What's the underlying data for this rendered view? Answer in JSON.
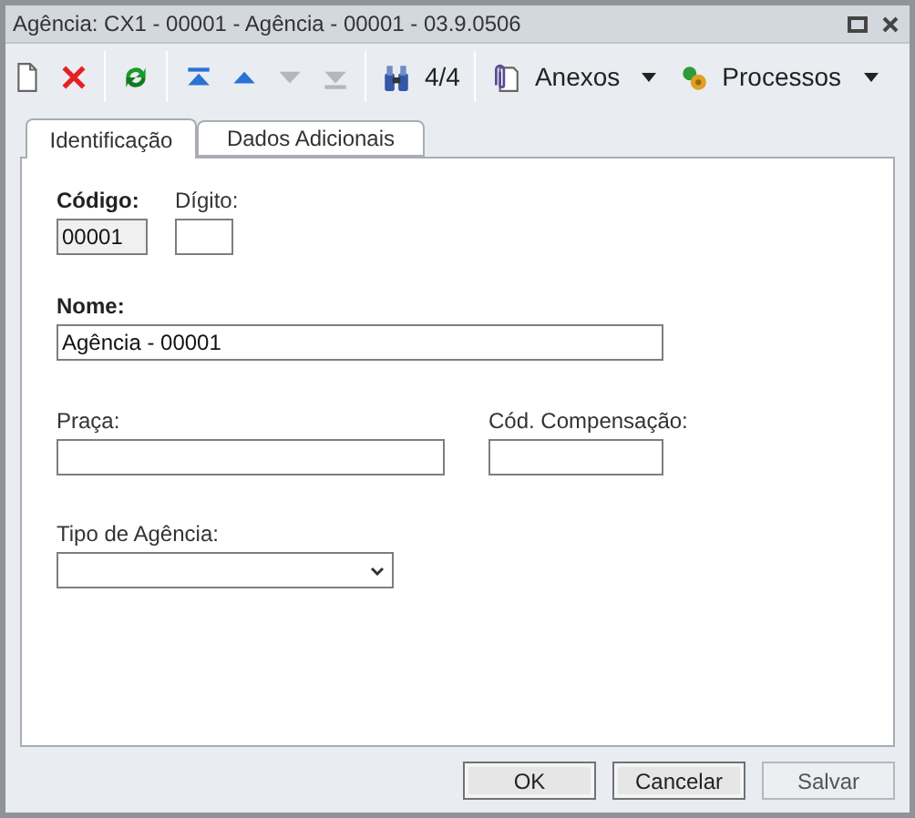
{
  "window": {
    "title": "Agência: CX1 - 00001 - Agência - 00001 - 03.9.0506"
  },
  "toolbar": [
    {
      "kind": "new",
      "disabled": false
    },
    {
      "kind": "delete",
      "disabled": false
    },
    {
      "kind": "separator"
    },
    {
      "kind": "refresh",
      "disabled": false
    },
    {
      "kind": "separator"
    },
    {
      "kind": "first",
      "disabled": false
    },
    {
      "kind": "previous",
      "disabled": false
    },
    {
      "kind": "next",
      "disabled": true
    },
    {
      "kind": "last",
      "disabled": true
    },
    {
      "kind": "separator"
    },
    {
      "kind": "find",
      "disabled": false,
      "label": "4/4"
    },
    {
      "kind": "separator"
    },
    {
      "kind": "attachments",
      "disabled": false,
      "label": "Anexos",
      "dropdown": true
    },
    {
      "kind": "processes",
      "disabled": false,
      "label": "Processos",
      "dropdown": true
    }
  ],
  "tabs": [
    {
      "label": "Identificação",
      "selected": true
    },
    {
      "label": "Dados Adicionais",
      "selected": false
    }
  ],
  "form_rows": [
    [
      {
        "label": "Código:",
        "bold": true,
        "kind": "text",
        "value": "00001",
        "disabled": true
      },
      {
        "label": "Dígito:",
        "bold": false,
        "kind": "text",
        "disabled": false
      }
    ],
    [
      {
        "label": "Nome:",
        "bold": true,
        "kind": "text",
        "value": "Agência - 00001",
        "disabled": false
      }
    ],
    [
      {
        "label": "Praça:",
        "bold": false,
        "kind": "text",
        "disabled": false
      },
      {
        "label": "Cód. Compensação:",
        "bold": false,
        "kind": "text",
        "disabled": false
      }
    ],
    [
      {
        "label": "Tipo de Agência:",
        "bold": false,
        "kind": "select",
        "disabled": false
      }
    ]
  ],
  "buttons": [
    {
      "label": "OK",
      "disabled": false
    },
    {
      "label": "Cancelar",
      "disabled": false
    },
    {
      "label": "Salvar",
      "disabled": true
    }
  ]
}
